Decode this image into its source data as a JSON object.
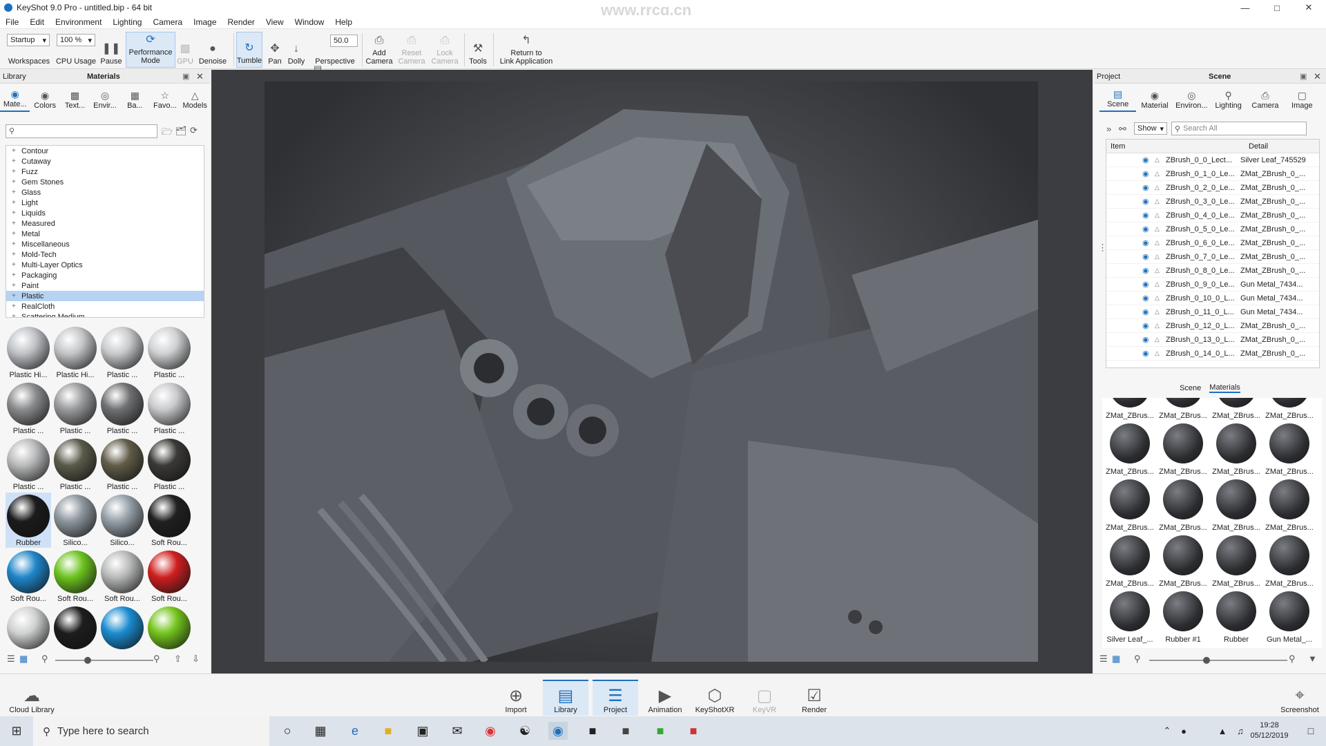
{
  "window": {
    "title": "KeyShot 9.0 Pro - untitled.bip - 64 bit",
    "watermark": "www.rrcg.cn"
  },
  "menu": [
    "File",
    "Edit",
    "Environment",
    "Lighting",
    "Camera",
    "Image",
    "Render",
    "View",
    "Window",
    "Help"
  ],
  "toolbar": {
    "workspace_value": "Startup",
    "workspace_label": "Workspaces",
    "cpu_value": "100 %",
    "cpu_label": "CPU Usage",
    "pause": "Pause",
    "perf_line1": "Performance",
    "perf_line2": "Mode",
    "gpu": "GPU",
    "denoise": "Denoise",
    "tumble": "Tumble",
    "pan": "Pan",
    "dolly": "Dolly",
    "perspective_value": "50.0",
    "perspective": "Perspective",
    "add_camera_1": "Add",
    "add_camera_2": "Camera",
    "reset_camera_1": "Reset",
    "reset_camera_2": "Camera",
    "lock_camera_1": "Lock",
    "lock_camera_2": "Camera",
    "tools": "Tools",
    "return_1": "Return to",
    "return_2": "Link Application"
  },
  "library": {
    "header_left": "Library",
    "header_center": "Materials",
    "tabs": [
      "Mate...",
      "Colors",
      "Text...",
      "Envir...",
      "Ba...",
      "Favo...",
      "Models"
    ],
    "tree": [
      "Contour",
      "Cutaway",
      "Fuzz",
      "Gem Stones",
      "Glass",
      "Light",
      "Liquids",
      "Measured",
      "Metal",
      "Miscellaneous",
      "Mold-Tech",
      "Multi-Layer Optics",
      "Packaging",
      "Paint",
      "Plastic",
      "RealCloth",
      "Scattering Medium"
    ],
    "selected_tree": "Plastic",
    "thumbs": [
      {
        "label": "Plastic Hi...",
        "color": "#bfc2c6"
      },
      {
        "label": "Plastic Hi...",
        "color": "#c3c5c8"
      },
      {
        "label": "Plastic ...",
        "color": "#c8cacc"
      },
      {
        "label": "Plastic ...",
        "color": "#cfd1d3"
      },
      {
        "label": "Plastic ...",
        "color": "#8a8b8d"
      },
      {
        "label": "Plastic ...",
        "color": "#9a9b9d"
      },
      {
        "label": "Plastic ...",
        "color": "#6f7072"
      },
      {
        "label": "Plastic ...",
        "color": "#c9cacc"
      },
      {
        "label": "Plastic ...",
        "color": "#b9babb"
      },
      {
        "label": "Plastic ...",
        "color": "#5b5a4a"
      },
      {
        "label": "Plastic ...",
        "color": "#605c48"
      },
      {
        "label": "Plastic ...",
        "color": "#3a3936"
      },
      {
        "label": "Rubber",
        "color": "#1b1b1c"
      },
      {
        "label": "Silico...",
        "color": "#8d969d"
      },
      {
        "label": "Silico...",
        "color": "#95a0a8"
      },
      {
        "label": "Soft Rou...",
        "color": "#202021"
      },
      {
        "label": "Soft Rou...",
        "color": "#1f86c9"
      },
      {
        "label": "Soft Rou...",
        "color": "#6cc31f"
      },
      {
        "label": "Soft Rou...",
        "color": "#b8b9ba"
      },
      {
        "label": "Soft Rou...",
        "color": "#cf1f1f"
      },
      {
        "label": "",
        "color": "#d0d1d2"
      },
      {
        "label": "",
        "color": "#1d1d1e"
      },
      {
        "label": "",
        "color": "#1a8bd0"
      },
      {
        "label": "",
        "color": "#74c41d"
      }
    ],
    "selected_thumb": "Rubber"
  },
  "project": {
    "header_left": "Project",
    "header_center": "Scene",
    "tabs": [
      "Scene",
      "Material",
      "Environ...",
      "Lighting",
      "Camera",
      "Image"
    ],
    "show": "Show",
    "search_placeholder": "Search All",
    "col_item": "Item",
    "col_detail": "Detail",
    "rows": [
      {
        "item": "ZBrush_0_0_Lect...",
        "detail": "Silver Leaf_745529"
      },
      {
        "item": "ZBrush_0_1_0_Le...",
        "detail": "ZMat_ZBrush_0_..."
      },
      {
        "item": "ZBrush_0_2_0_Le...",
        "detail": "ZMat_ZBrush_0_..."
      },
      {
        "item": "ZBrush_0_3_0_Le...",
        "detail": "ZMat_ZBrush_0_..."
      },
      {
        "item": "ZBrush_0_4_0_Le...",
        "detail": "ZMat_ZBrush_0_..."
      },
      {
        "item": "ZBrush_0_5_0_Le...",
        "detail": "ZMat_ZBrush_0_..."
      },
      {
        "item": "ZBrush_0_6_0_Le...",
        "detail": "ZMat_ZBrush_0_..."
      },
      {
        "item": "ZBrush_0_7_0_Le...",
        "detail": "ZMat_ZBrush_0_..."
      },
      {
        "item": "ZBrush_0_8_0_Le...",
        "detail": "ZMat_ZBrush_0_..."
      },
      {
        "item": "ZBrush_0_9_0_Le...",
        "detail": "Gun Metal_7434..."
      },
      {
        "item": "ZBrush_0_10_0_L...",
        "detail": "Gun Metal_7434..."
      },
      {
        "item": "ZBrush_0_11_0_L...",
        "detail": "Gun Metal_7434..."
      },
      {
        "item": "ZBrush_0_12_0_L...",
        "detail": "ZMat_ZBrush_0_..."
      },
      {
        "item": "ZBrush_0_13_0_L...",
        "detail": "ZMat_ZBrush_0_..."
      },
      {
        "item": "ZBrush_0_14_0_L...",
        "detail": "ZMat_ZBrush_0_..."
      }
    ],
    "subtabs": [
      "Scene",
      "Materials"
    ],
    "materials": [
      "ZMat_ZBrus...",
      "ZMat_ZBrus...",
      "ZMat_ZBrus...",
      "ZMat_ZBrus...",
      "ZMat_ZBrus...",
      "ZMat_ZBrus...",
      "ZMat_ZBrus...",
      "ZMat_ZBrus...",
      "ZMat_ZBrus...",
      "ZMat_ZBrus...",
      "ZMat_ZBrus...",
      "ZMat_ZBrus...",
      "ZMat_ZBrus...",
      "ZMat_ZBrus...",
      "ZMat_ZBrus...",
      "ZMat_ZBrus...",
      "Silver Leaf_...",
      "Rubber #1",
      "Rubber",
      "Gun Metal_..."
    ]
  },
  "bottom": {
    "cloud_library": "Cloud Library",
    "import": "Import",
    "library": "Library",
    "project": "Project",
    "animation": "Animation",
    "keyshotxr": "KeyShotXR",
    "keyvr": "KeyVR",
    "render": "Render",
    "screenshot": "Screenshot"
  },
  "taskbar": {
    "search_placeholder": "Type here to search",
    "time": "19:28",
    "date": "05/12/2019"
  }
}
